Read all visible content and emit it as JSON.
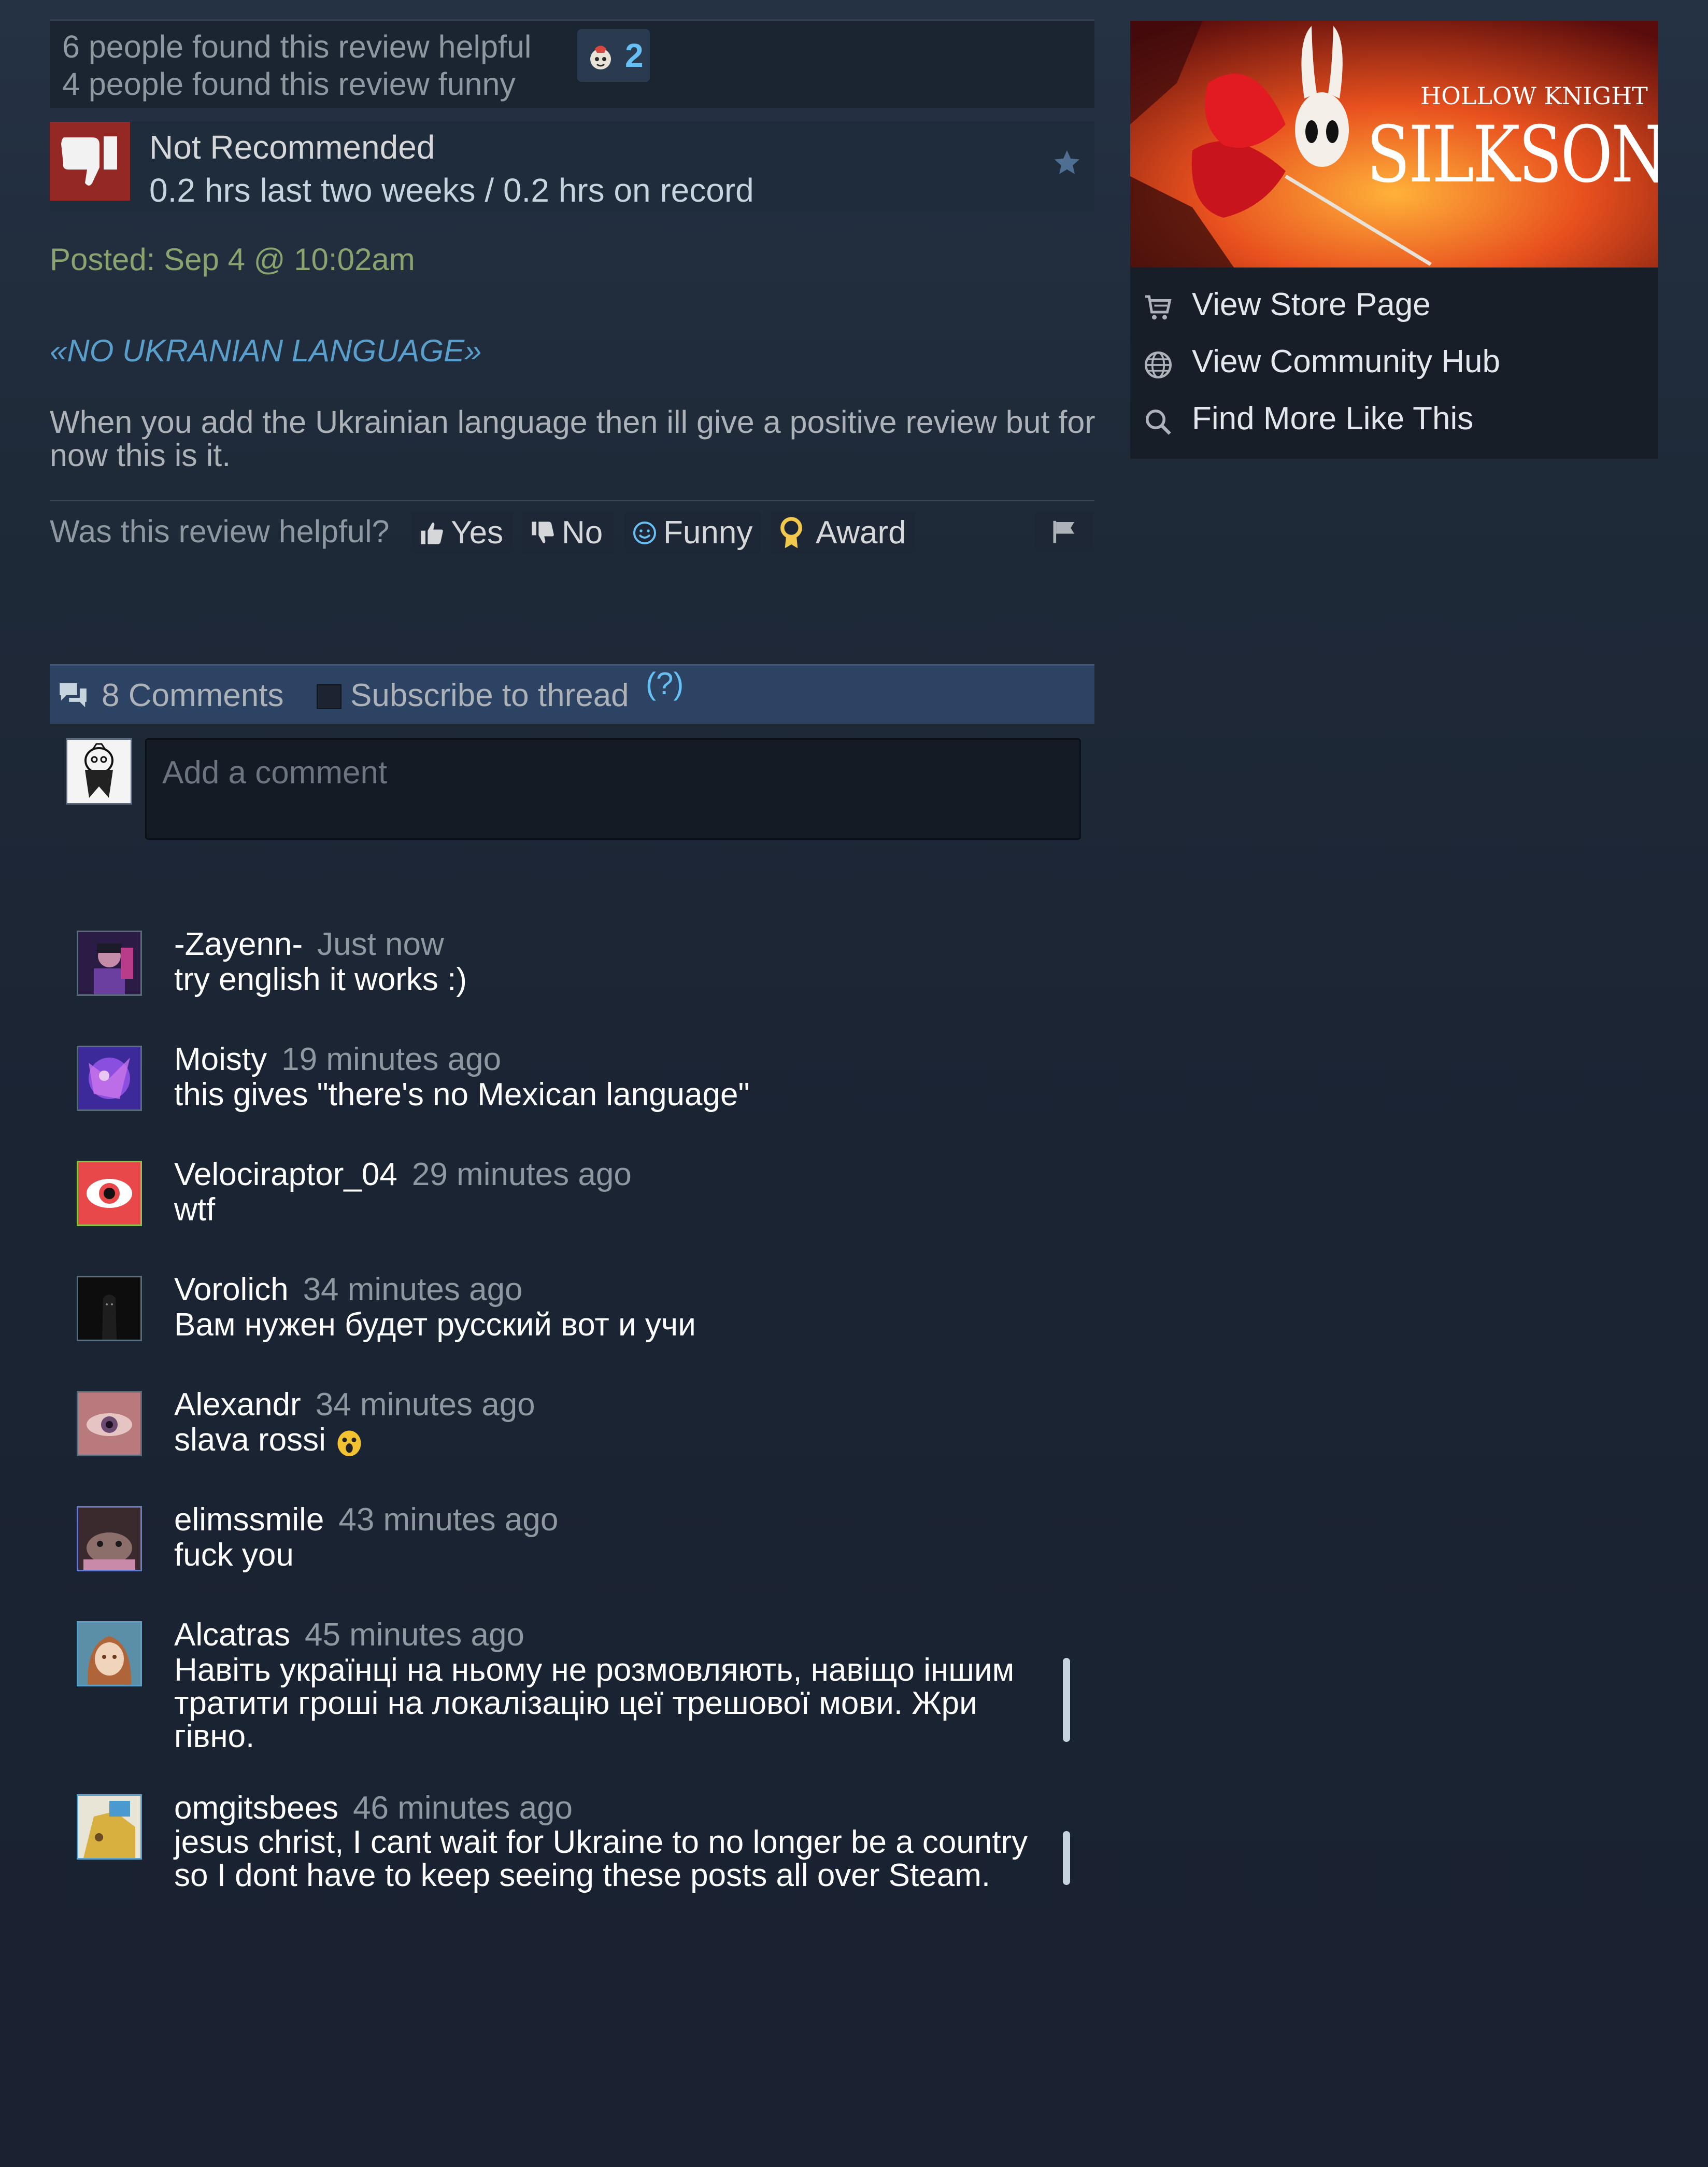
{
  "review": {
    "helpful_count_text": "6 people found this review helpful",
    "funny_count_text": "4 people found this review funny",
    "award_count": "2",
    "recommendation": "Not Recommended",
    "hours": "0.2 hrs last two weeks / 0.2 hrs on record",
    "posted": "Posted: Sep 4 @ 10:02am",
    "title": "«NO UKRANIAN LANGUAGE»",
    "body": "When you add the Ukrainian language then ill give a positive review but for now this is it."
  },
  "vote": {
    "question": "Was this review helpful?",
    "yes": "Yes",
    "no": "No",
    "funny": "Funny",
    "award": "Award"
  },
  "comments_header": {
    "count_label": "8 Comments",
    "subscribe_label": "Subscribe to thread",
    "help": "(?)"
  },
  "comment_input": {
    "placeholder": "Add a comment"
  },
  "comments": [
    {
      "author": "-Zayenn-",
      "time": "Just now",
      "text": "try english it works :)"
    },
    {
      "author": "Moisty",
      "time": "19 minutes ago",
      "text": "this gives \"there's no Mexican language\""
    },
    {
      "author": "Velociraptor_04",
      "time": "29 minutes ago",
      "text": "wtf"
    },
    {
      "author": "Vorolich",
      "time": "34 minutes ago",
      "text": "Вам нужен будет русский вот и учи"
    },
    {
      "author": "Alexandr",
      "time": "34 minutes ago",
      "text": "slava rossi"
    },
    {
      "author": "elimssmile",
      "time": "43 minutes ago",
      "text": "fuck you"
    },
    {
      "author": "Alcatras",
      "time": "45 minutes ago",
      "text": "Навіть українці на ньому не розмовляють, навіщо іншим тратити гроші на локалізацію цеї трешової мови. Жри гівно."
    },
    {
      "author": "omgitsbees",
      "time": "46 minutes ago",
      "text": "jesus christ, I cant wait for Ukraine to no longer be a country so I dont have to keep seeing these posts all over Steam."
    }
  ],
  "sidebar": {
    "game_logo_top": "HOLLOW KNIGHT",
    "game_logo_main": "SILKSONG",
    "links": [
      {
        "label": "View Store Page",
        "icon": "cart-icon"
      },
      {
        "label": "View Community Hub",
        "icon": "globe-icon"
      },
      {
        "label": "Find More Like This",
        "icon": "search-icon"
      }
    ]
  },
  "colors": {
    "accent": "#66c0f4",
    "posted": "#8ba36e",
    "title": "#5a9fcc",
    "not_recommended": "#932824"
  }
}
